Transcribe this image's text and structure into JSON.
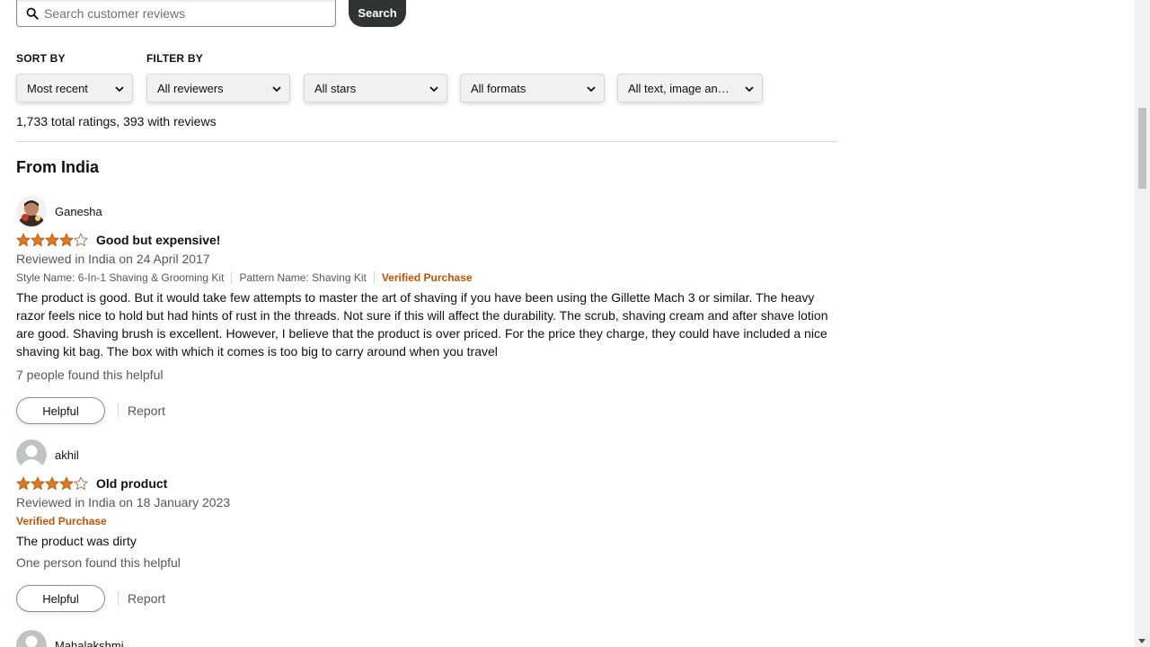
{
  "search": {
    "placeholder": "Search customer reviews",
    "button_label": "Search"
  },
  "sort": {
    "label": "SORT BY",
    "value": "Most recent"
  },
  "filter": {
    "label": "FILTER BY",
    "reviewers": "All reviewers",
    "stars": "All stars",
    "formats": "All formats",
    "media": "All text, image an…"
  },
  "totals": "1,733 total ratings, 393 with reviews",
  "section_heading": "From India",
  "reviews": [
    {
      "name": "Ganesha",
      "rating": 4,
      "title": "Good but expensive!",
      "date": "Reviewed in India on 24 April 2017",
      "style": "Style Name: 6-In-1 Shaving & Grooming Kit",
      "pattern": "Pattern Name: Shaving Kit",
      "verified": "Verified Purchase",
      "body": "The product is good. But it would take few attempts to master the art of shaving if you have been using the Gillette Mach 3 or similar. The heavy razor feels nice to hold but had hints of rust in the threads. Not sure if this will affect the durability. The scrub, shaving cream and after shave lotion are good. Shaving brush is excellent. However, I believe that the product is over priced. For the price they charge, they could have included a nice shaving kit bag. The box with which it comes is too big to carry around when you travel",
      "helpful_count": "7 people found this helpful",
      "helpful_label": "Helpful",
      "report_label": "Report"
    },
    {
      "name": "akhil",
      "rating": 4,
      "title": "Old product",
      "date": "Reviewed in India on 18 January 2023",
      "verified": "Verified Purchase",
      "body": "The product was dirty",
      "helpful_count": "One person found this helpful",
      "helpful_label": "Helpful",
      "report_label": "Report"
    },
    {
      "name": "Mahalakshmi"
    }
  ],
  "colors": {
    "star": "#de7921",
    "verified": "#c45500",
    "search_button": "#303333"
  }
}
